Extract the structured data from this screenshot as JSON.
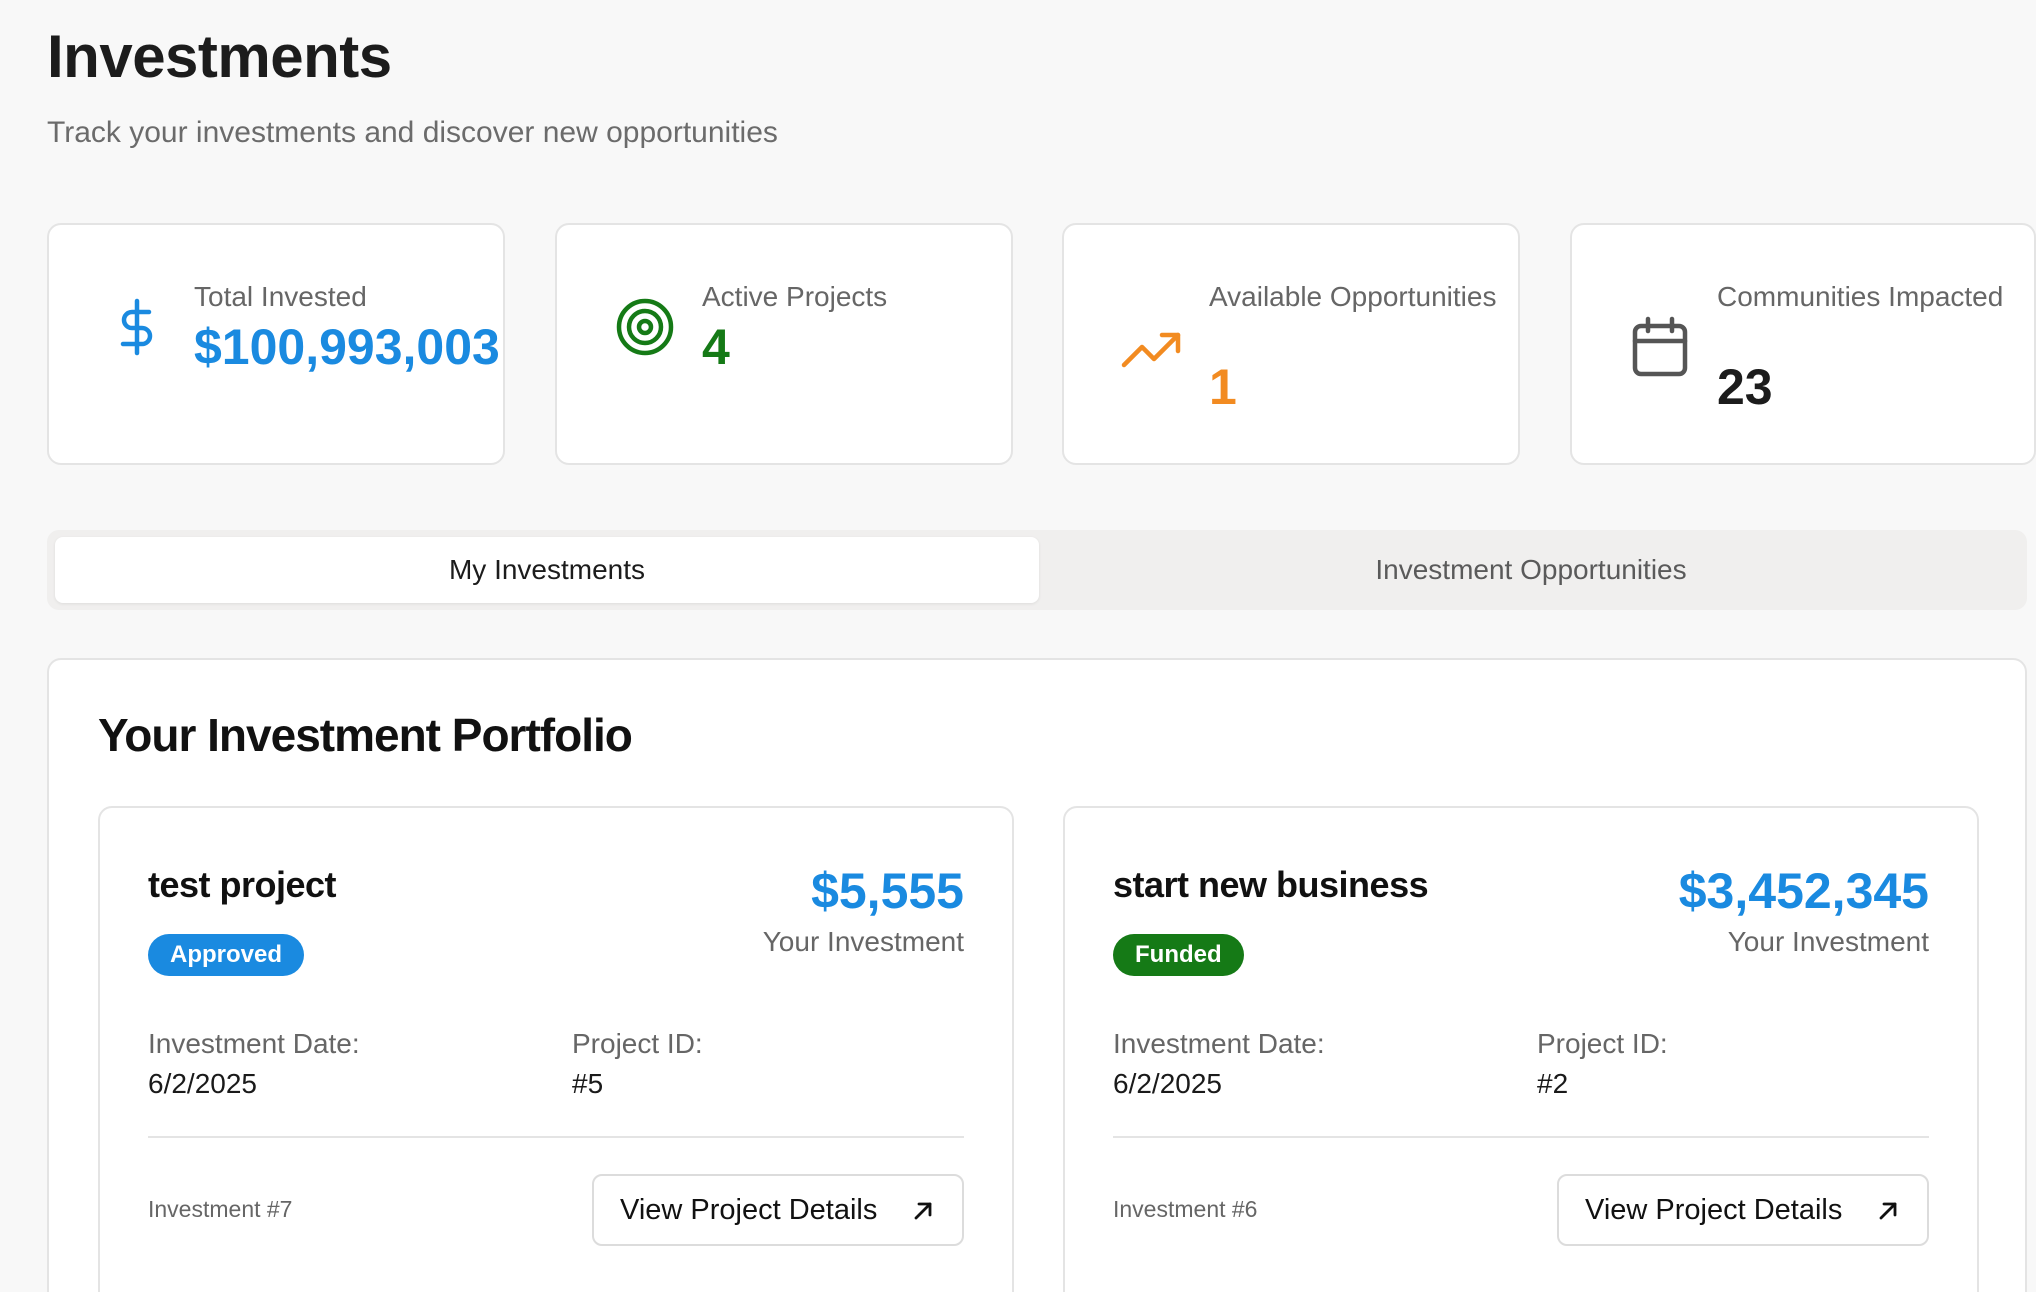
{
  "header": {
    "title": "Investments",
    "subtitle": "Track your investments and discover new opportunities"
  },
  "stats": [
    {
      "label": "Total Invested",
      "value": "$100,993,003",
      "icon": "dollar-icon",
      "color": "#1a8ae0"
    },
    {
      "label": "Active Projects",
      "value": "4",
      "icon": "target-icon",
      "color": "#157a16"
    },
    {
      "label": "Available Opportunities",
      "value": "1",
      "icon": "trending-up-icon",
      "color": "#f28b21"
    },
    {
      "label": "Communities Impacted",
      "value": "23",
      "icon": "calendar-icon",
      "color": "#1c1c1c"
    }
  ],
  "tabs": [
    {
      "label": "My Investments",
      "active": true
    },
    {
      "label": "Investment Opportunities",
      "active": false
    }
  ],
  "portfolio": {
    "title": "Your Investment Portfolio",
    "items": [
      {
        "name": "test project",
        "status": "Approved",
        "status_color": "#1a8ae0",
        "amount": "$5,555",
        "amount_label": "Your Investment",
        "date_label": "Investment Date:",
        "date": "6/2/2025",
        "project_id_label": "Project ID:",
        "project_id": "#5",
        "investment_number": "Investment #7",
        "button_label": "View Project Details"
      },
      {
        "name": "start new business",
        "status": "Funded",
        "status_color": "#157a16",
        "amount": "$3,452,345",
        "amount_label": "Your Investment",
        "date_label": "Investment Date:",
        "date": "6/2/2025",
        "project_id_label": "Project ID:",
        "project_id": "#2",
        "investment_number": "Investment #6",
        "button_label": "View Project Details"
      }
    ]
  }
}
